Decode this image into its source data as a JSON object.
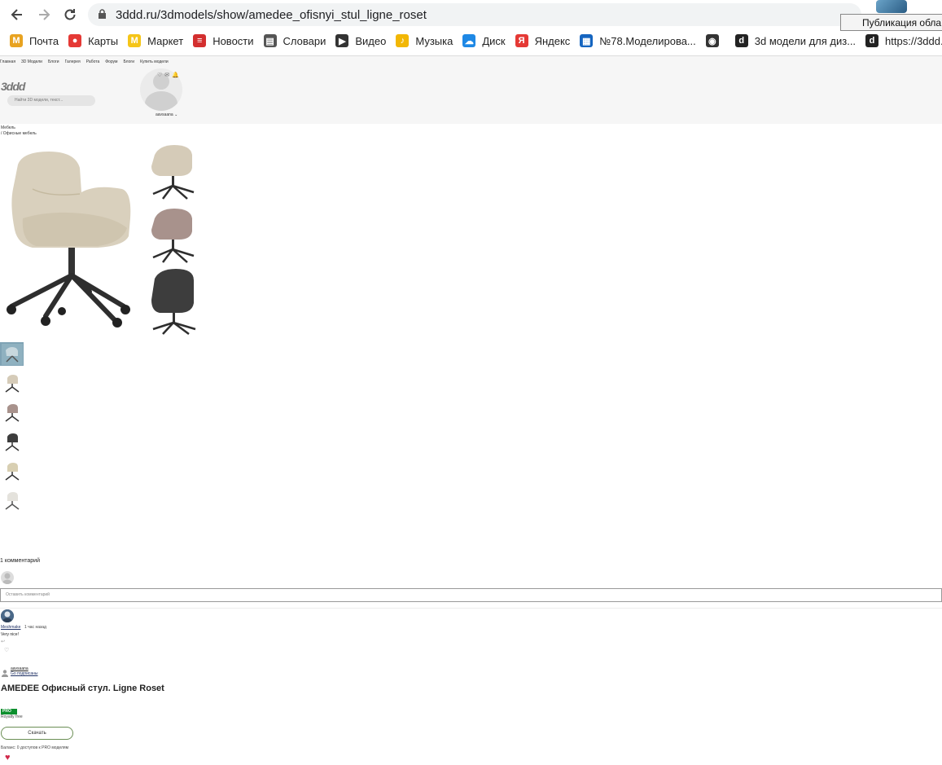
{
  "browser": {
    "url": "3ddd.ru/3dmodels/show/amedee_ofisnyi_stul_ligne_roset",
    "tooltip": "Публикация обла",
    "bookmarks": [
      {
        "label": "Почта",
        "icon": "mail-icon",
        "color": "#e8a321"
      },
      {
        "label": "Карты",
        "icon": "map-pin-icon",
        "color": "#e53935"
      },
      {
        "label": "Маркет",
        "icon": "market-icon",
        "color": "#f5c518"
      },
      {
        "label": "Новости",
        "icon": "news-icon",
        "color": "#d32f2f"
      },
      {
        "label": "Словари",
        "icon": "dictionary-icon",
        "color": "#555555"
      },
      {
        "label": "Видео",
        "icon": "video-icon",
        "color": "#333333"
      },
      {
        "label": "Музыка",
        "icon": "music-icon",
        "color": "#f2b705"
      },
      {
        "label": "Диск",
        "icon": "disk-icon",
        "color": "#1e88e5"
      },
      {
        "label": "Яндекс",
        "icon": "yandex-icon",
        "color": "#e53935"
      },
      {
        "label": "№78.Моделирова...",
        "icon": "document-icon",
        "color": "#1565c0"
      },
      {
        "label": "",
        "icon": "globe-icon",
        "color": "#333333"
      },
      {
        "label": "3d модели для диз...",
        "icon": "3ddd-icon",
        "color": "#222222"
      },
      {
        "label": "https://3ddd.ru",
        "icon": "3ddd-icon",
        "color": "#222222"
      }
    ]
  },
  "site": {
    "nav": [
      "Главная",
      "3D Модели",
      "Блоги",
      "Галерея",
      "Работа",
      "Форум",
      "Блоги",
      "Купить модели"
    ],
    "logo": "3ddd",
    "search_placeholder": "Найти 3D модели, текст...",
    "username": "aavsaana ⌄",
    "icons": [
      "♡",
      "✉",
      "🔔"
    ]
  },
  "breadcrumb": {
    "line1": "Мебель",
    "line2": "/ Офисные мебель"
  },
  "comments": {
    "title": "1 комментарий",
    "input_placeholder": "Оставить комментарий",
    "items": [
      {
        "author": "Meshmake",
        "time": "1 час назад",
        "text": "Very nice!",
        "reply": "↩",
        "like": "♡"
      }
    ]
  },
  "author": {
    "name": "aavsaana",
    "subscribe": "Go подписаны"
  },
  "model": {
    "title": "AMEDEE Офисный стул. Ligne Roset",
    "badge": "PRO",
    "license": "Royalty free",
    "download_label": "Скачать",
    "balance": "Баланс: 0 доступов к PRO моделям"
  }
}
